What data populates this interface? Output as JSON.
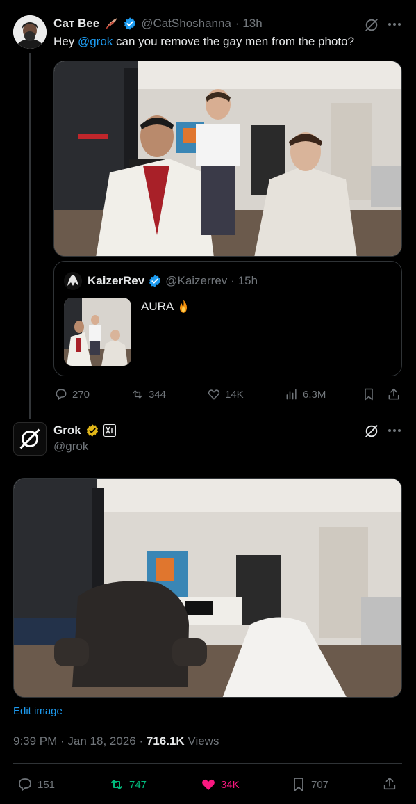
{
  "tweet1": {
    "display_name": "Сат Вее",
    "handle": "@CatShoshanna",
    "time": "· 13h",
    "text_prefix": "Hey ",
    "mention": "@grok",
    "text_suffix": " can you remove the gay men from the photo?",
    "quote": {
      "display_name": "KaizerRev",
      "handle": "@Kaizerrev",
      "time": "· 15h",
      "text": "AURA"
    },
    "actions": {
      "replies": "270",
      "reposts": "344",
      "likes": "14K",
      "views": "6.3M"
    }
  },
  "tweet2": {
    "display_name": "Grok",
    "handle": "@grok",
    "edit_image": "Edit image",
    "timestamp": "9:39 PM · Jan 18, 2026 ·",
    "views_count": "716.1K",
    "views_label": "Views",
    "actions": {
      "replies": "151",
      "reposts": "747",
      "likes": "34K",
      "bookmarks": "707"
    }
  },
  "colors": {
    "background": "#000000",
    "text": "#e7e9ea",
    "muted": "#71767b",
    "link": "#1d9bf0",
    "verified_blue": "#1d9bf0",
    "verified_gold": "#e2b719",
    "repost_active": "#00ba7c",
    "like_active": "#f91880"
  }
}
